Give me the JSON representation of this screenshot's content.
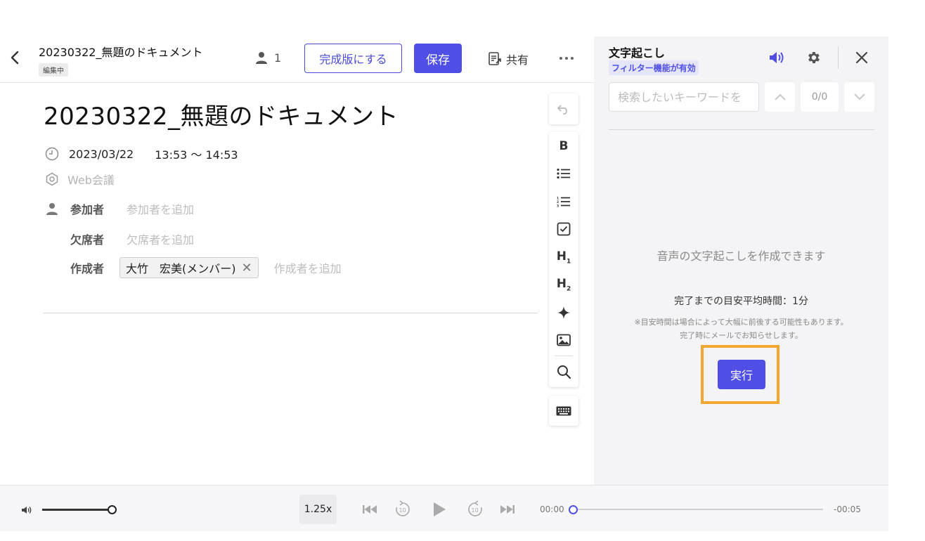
{
  "header": {
    "doc_title": "20230322_無題のドキュメント",
    "status": "編集中",
    "participant_count": "1",
    "finalize_label": "完成版にする",
    "save_label": "保存",
    "share_label": "共有"
  },
  "document": {
    "title": "20230322_無題のドキュメント",
    "date": "2023/03/22",
    "time_range": "13:53 〜 14:53",
    "meeting_type": "Web会議",
    "attendees_label": "参加者",
    "attendees_placeholder": "参加者を追加",
    "absent_label": "欠席者",
    "absent_placeholder": "欠席者を追加",
    "creator_label": "作成者",
    "creator_name": "大竹　宏美(メンバー)",
    "creator_placeholder": "作成者を追加"
  },
  "toolbar": {
    "bold": "B",
    "h1": "H",
    "h1_sub": "1",
    "h2": "H",
    "h2_sub": "2"
  },
  "transcription": {
    "title": "文字起こし",
    "filter_badge": "フィルター機能が有効",
    "search_placeholder": "検索したいキーワードを",
    "match_count": "0/0",
    "empty_message": "音声の文字起こしを作成できます",
    "avg_time": "完了までの目安平均時間：1分",
    "note_line1": "※目安時間は場合によって大幅に前後する可能性もあります。",
    "note_line2": "完了時にメールでお知らせします。",
    "run_label": "実行"
  },
  "player": {
    "speed": "1.25x",
    "current_time": "00:00",
    "remaining_time": "-00:05",
    "volume_level": 1.0,
    "progress": 0.0
  },
  "colors": {
    "accent": "#4f4fe6",
    "highlight": "#f0a830"
  }
}
